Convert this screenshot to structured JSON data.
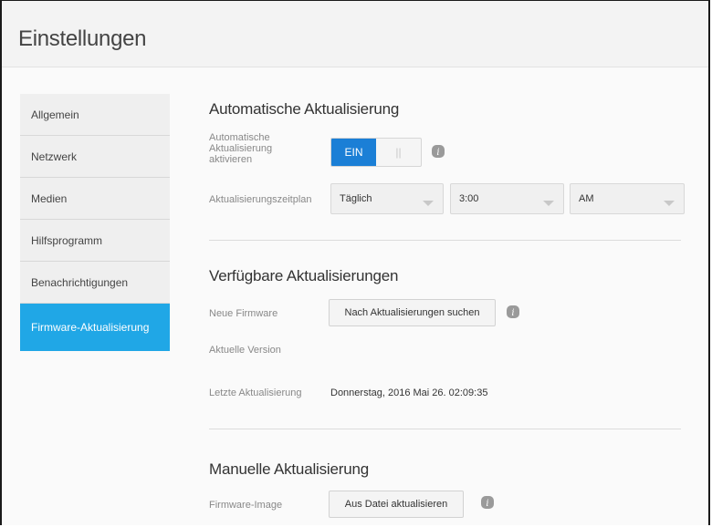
{
  "header": {
    "title": "Einstellungen"
  },
  "sidebar": {
    "items": [
      {
        "label": "Allgemein"
      },
      {
        "label": "Netzwerk"
      },
      {
        "label": "Medien"
      },
      {
        "label": "Hilfsprogramm"
      },
      {
        "label": "Benachrichtigungen"
      },
      {
        "label": "Firmware-Aktualisierung"
      }
    ],
    "active_index": 5
  },
  "auto_update": {
    "title": "Automatische Aktualisierung",
    "enable_label": "Automatische Aktualisierung aktivieren",
    "toggle_on_label": "EIN",
    "toggle_off_label": "||",
    "schedule_label": "Aktualisierungszeitplan",
    "schedule_day": "Täglich",
    "schedule_time": "3:00",
    "schedule_ampm": "AM"
  },
  "available_updates": {
    "title": "Verfügbare Aktualisierungen",
    "new_firmware_label": "Neue Firmware",
    "check_button": "Nach Aktualisierungen suchen",
    "current_version_label": "Aktuelle Version",
    "last_update_label": "Letzte Aktualisierung",
    "last_update_value": "Donnerstag, 2016 Mai 26. 02:09:35"
  },
  "manual_update": {
    "title": "Manuelle Aktualisierung",
    "image_label": "Firmware-Image",
    "file_button": "Aus Datei aktualisieren"
  },
  "colors": {
    "accent": "#20a7e6",
    "toggle_blue": "#1b7fd6"
  },
  "icons": {
    "info": "info-icon"
  }
}
